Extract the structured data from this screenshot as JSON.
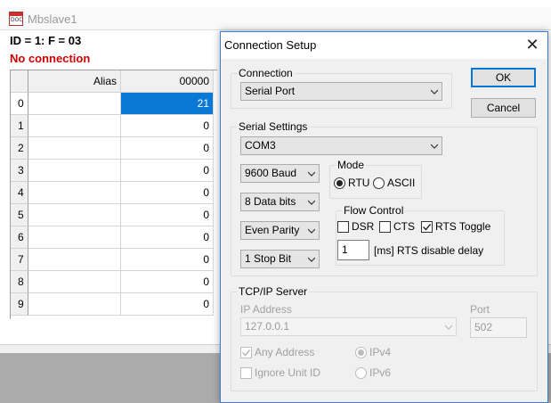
{
  "window": {
    "title": "Mbslave1",
    "icon_text": "DOC",
    "status_line": "ID = 1: F = 03",
    "connection_status": "No connection"
  },
  "grid": {
    "columns": [
      "Alias",
      "00000"
    ],
    "rows": [
      {
        "index": "0",
        "alias": "",
        "value": "21",
        "selected": true
      },
      {
        "index": "1",
        "alias": "",
        "value": "0"
      },
      {
        "index": "2",
        "alias": "",
        "value": "0"
      },
      {
        "index": "3",
        "alias": "",
        "value": "0"
      },
      {
        "index": "4",
        "alias": "",
        "value": "0"
      },
      {
        "index": "5",
        "alias": "",
        "value": "0"
      },
      {
        "index": "6",
        "alias": "",
        "value": "0"
      },
      {
        "index": "7",
        "alias": "",
        "value": "0"
      },
      {
        "index": "8",
        "alias": "",
        "value": "0"
      },
      {
        "index": "9",
        "alias": "",
        "value": "0"
      }
    ]
  },
  "dialog": {
    "title": "Connection Setup",
    "ok_label": "OK",
    "cancel_label": "Cancel",
    "connection": {
      "label": "Connection",
      "value": "Serial Port"
    },
    "serial": {
      "label": "Serial Settings",
      "port": "COM3",
      "baud": "9600 Baud",
      "data_bits": "8 Data bits",
      "parity": "Even Parity",
      "stop_bits": "1 Stop Bit",
      "mode": {
        "label": "Mode",
        "rtu": "RTU",
        "ascii": "ASCII",
        "selected": "RTU"
      },
      "flow": {
        "label": "Flow Control",
        "dsr": "DSR",
        "cts": "CTS",
        "rts_toggle": "RTS Toggle",
        "rts_toggle_checked": true,
        "delay_value": "1",
        "delay_label": "[ms] RTS disable delay"
      }
    },
    "tcp": {
      "label": "TCP/IP Server",
      "ip_label": "IP Address",
      "ip_value": "127.0.0.1",
      "port_label": "Port",
      "port_value": "502",
      "any_address": "Any Address",
      "any_address_checked": true,
      "ignore_unit_id": "Ignore Unit ID",
      "ipv4": "IPv4",
      "ipv6": "IPv6",
      "ip_version_selected": "IPv4"
    }
  },
  "colors": {
    "selection": "#0a79d6",
    "error_text": "#d00000",
    "dialog_border": "#3c7ad6",
    "default_button": "#0078d7"
  }
}
